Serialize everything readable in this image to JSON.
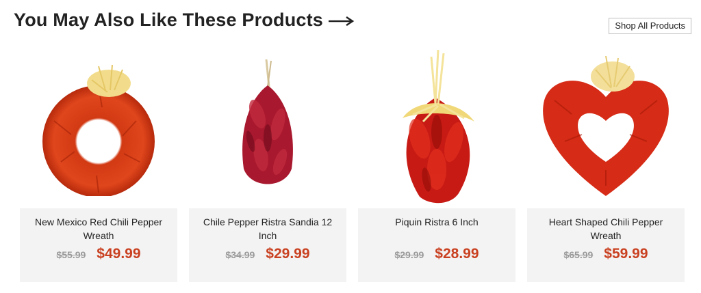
{
  "header": {
    "title": "You May Also Like These Products",
    "shop_all_label": "Shop All Products"
  },
  "products": [
    {
      "name": "New Mexico Red Chili Pepper Wreath",
      "old_price": "$55.99",
      "new_price": "$49.99",
      "image_icon": "chili-wreath-image"
    },
    {
      "name": "Chile Pepper Ristra Sandia 12 Inch",
      "old_price": "$34.99",
      "new_price": "$29.99",
      "image_icon": "chile-ristra-image"
    },
    {
      "name": "Piquin Ristra 6 Inch",
      "old_price": "$29.99",
      "new_price": "$28.99",
      "image_icon": "piquin-ristra-image"
    },
    {
      "name": "Heart Shaped Chili Pepper Wreath",
      "old_price": "$65.99",
      "new_price": "$59.99",
      "image_icon": "heart-wreath-image"
    }
  ],
  "colors": {
    "sale_price": "#c94020",
    "old_price": "#9a9a9a",
    "card_bg": "#f3f3f3"
  }
}
